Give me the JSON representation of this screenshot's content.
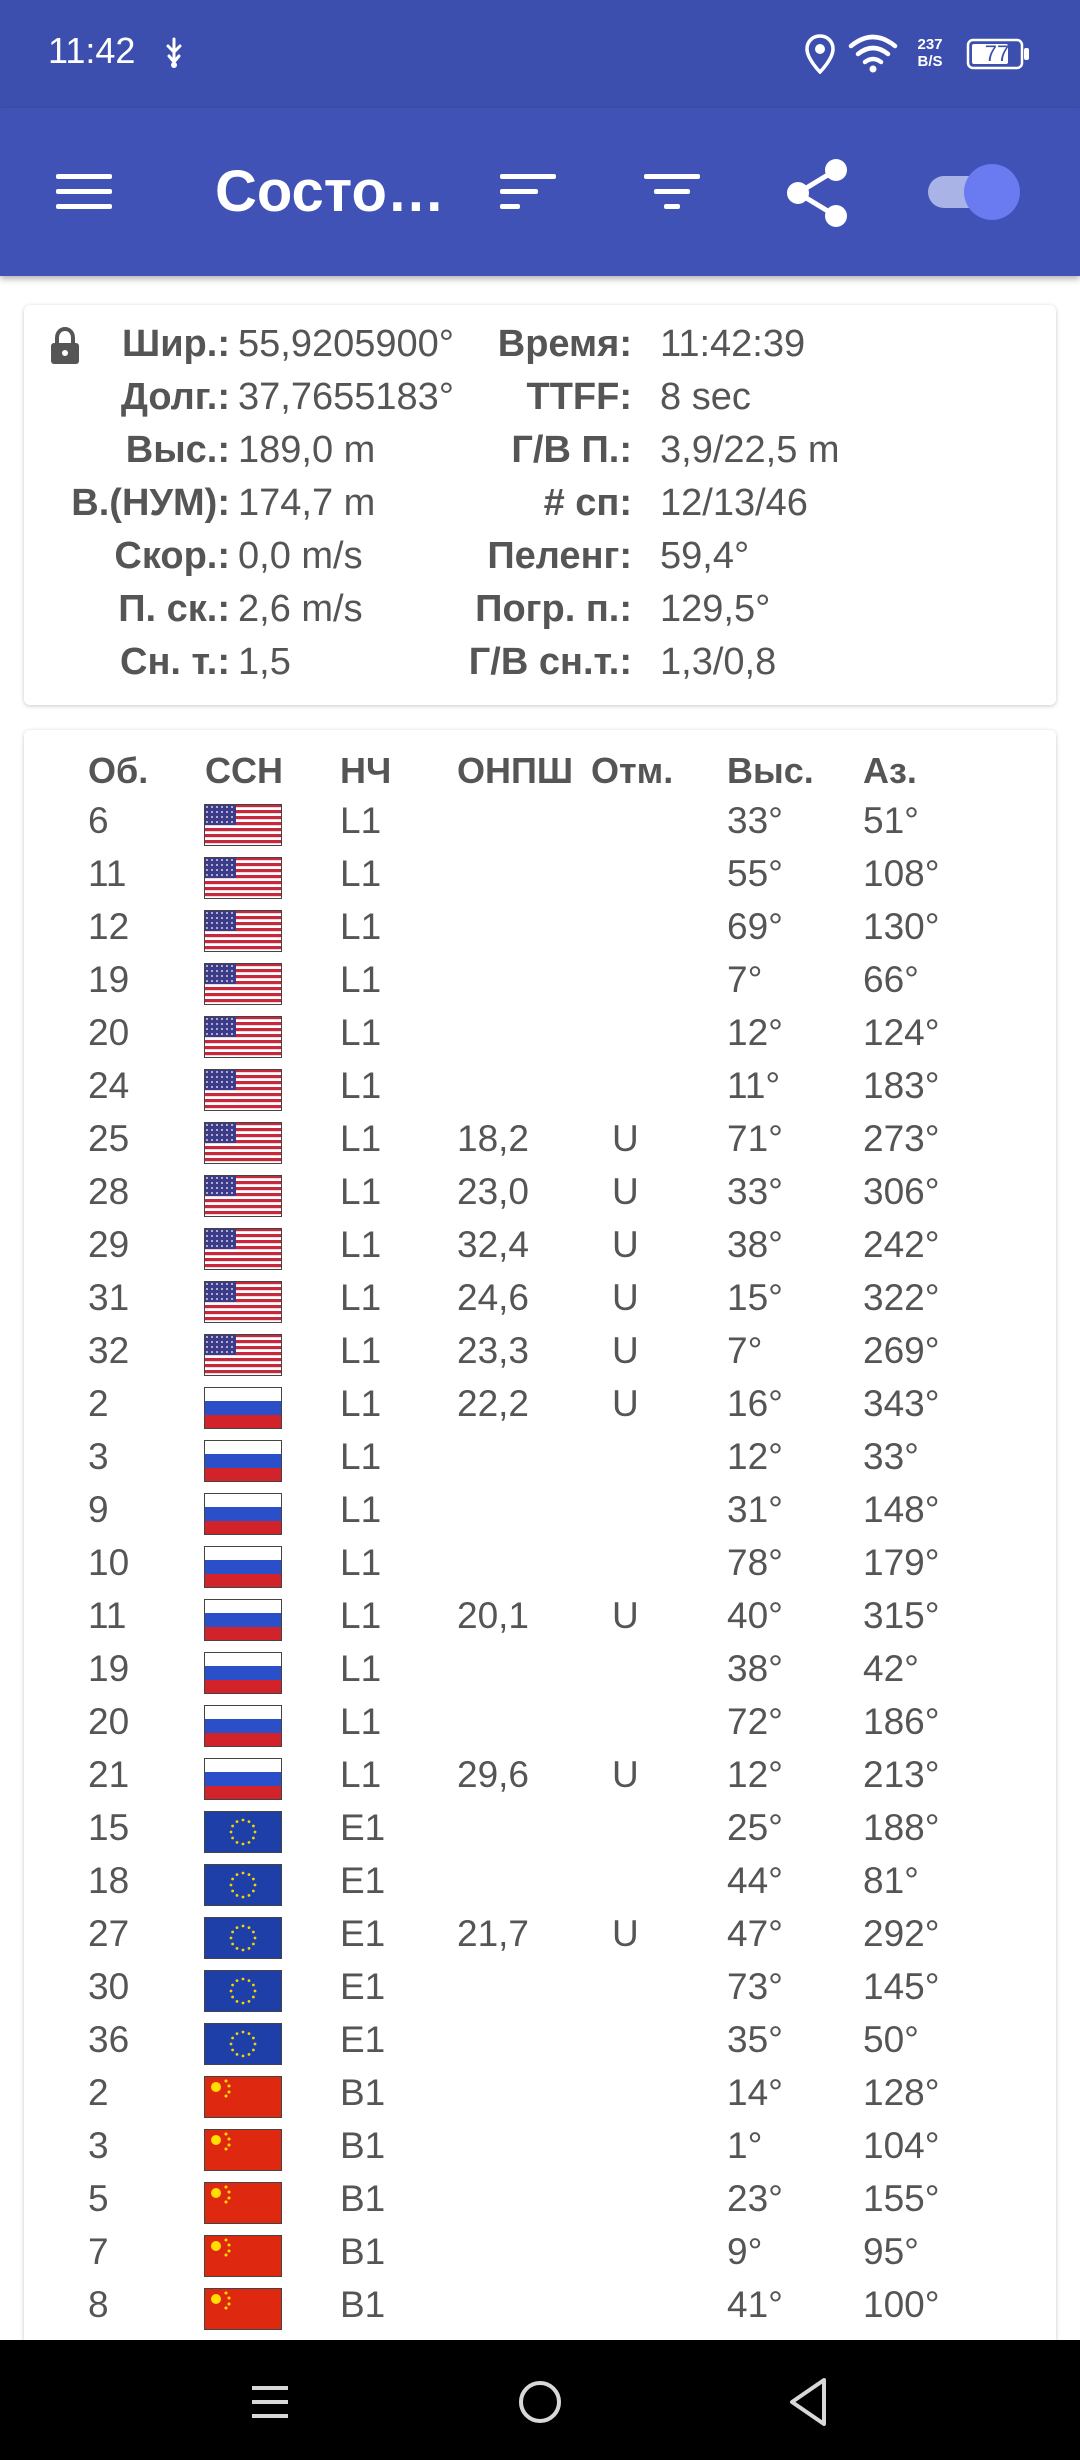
{
  "status_bar": {
    "time": "11:42",
    "speed_value": "237",
    "speed_unit": "B/S",
    "battery": "77",
    "icons": [
      "usb-debug-icon",
      "location-icon",
      "wifi-icon",
      "battery-icon"
    ]
  },
  "app_bar": {
    "title": "Состо…",
    "icons": [
      "menu-icon",
      "sort-icon",
      "filter-icon",
      "share-icon",
      "toggle-switch"
    ],
    "toggle_on": true
  },
  "colors": {
    "status_bar": "#3d4fae",
    "app_bar": "#4052b5",
    "toggle_knob": "#6a7af0",
    "toggle_track": "#aab3e6"
  },
  "location": {
    "rows": [
      {
        "l1": "Шир.:",
        "v1": "55,9205900°",
        "l2": "Время:",
        "v2": "11:42:39"
      },
      {
        "l1": "Долг.:",
        "v1": "37,7655183°",
        "l2": "TTFF:",
        "v2": "8 sec"
      },
      {
        "l1": "Выс.:",
        "v1": "189,0 m",
        "l2": "Г/В П.:",
        "v2": "3,9/22,5 m"
      },
      {
        "l1": "В.(НУМ):",
        "v1": "174,7 m",
        "l2": "# сп:",
        "v2": "12/13/46"
      },
      {
        "l1": "Скор.:",
        "v1": "0,0 m/s",
        "l2": "Пеленг:",
        "v2": "59,4°"
      },
      {
        "l1": "П. ск.:",
        "v1": "2,6 m/s",
        "l2": "Погр. п.:",
        "v2": "129,5°"
      },
      {
        "l1": "Сн. т.:",
        "v1": "1,5",
        "l2": "Г/В сн.т.:",
        "v2": "1,3/0,8"
      }
    ]
  },
  "satellites": {
    "headers": {
      "num": "Об.",
      "gnss": "ССН",
      "band": "НЧ",
      "snr": "ОНПШ",
      "used": "Отм.",
      "elev": "Выс.",
      "az": "Аз."
    },
    "rows": [
      {
        "num": "6",
        "flag": "usa",
        "band": "L1",
        "snr": "",
        "used": "",
        "elev": "33°",
        "az": "51°"
      },
      {
        "num": "11",
        "flag": "usa",
        "band": "L1",
        "snr": "",
        "used": "",
        "elev": "55°",
        "az": "108°"
      },
      {
        "num": "12",
        "flag": "usa",
        "band": "L1",
        "snr": "",
        "used": "",
        "elev": "69°",
        "az": "130°"
      },
      {
        "num": "19",
        "flag": "usa",
        "band": "L1",
        "snr": "",
        "used": "",
        "elev": "7°",
        "az": "66°"
      },
      {
        "num": "20",
        "flag": "usa",
        "band": "L1",
        "snr": "",
        "used": "",
        "elev": "12°",
        "az": "124°"
      },
      {
        "num": "24",
        "flag": "usa",
        "band": "L1",
        "snr": "",
        "used": "",
        "elev": "11°",
        "az": "183°"
      },
      {
        "num": "25",
        "flag": "usa",
        "band": "L1",
        "snr": "18,2",
        "used": "U",
        "elev": "71°",
        "az": "273°"
      },
      {
        "num": "28",
        "flag": "usa",
        "band": "L1",
        "snr": "23,0",
        "used": "U",
        "elev": "33°",
        "az": "306°"
      },
      {
        "num": "29",
        "flag": "usa",
        "band": "L1",
        "snr": "32,4",
        "used": "U",
        "elev": "38°",
        "az": "242°"
      },
      {
        "num": "31",
        "flag": "usa",
        "band": "L1",
        "snr": "24,6",
        "used": "U",
        "elev": "15°",
        "az": "322°"
      },
      {
        "num": "32",
        "flag": "usa",
        "band": "L1",
        "snr": "23,3",
        "used": "U",
        "elev": "7°",
        "az": "269°"
      },
      {
        "num": "2",
        "flag": "russia",
        "band": "L1",
        "snr": "22,2",
        "used": "U",
        "elev": "16°",
        "az": "343°"
      },
      {
        "num": "3",
        "flag": "russia",
        "band": "L1",
        "snr": "",
        "used": "",
        "elev": "12°",
        "az": "33°"
      },
      {
        "num": "9",
        "flag": "russia",
        "band": "L1",
        "snr": "",
        "used": "",
        "elev": "31°",
        "az": "148°"
      },
      {
        "num": "10",
        "flag": "russia",
        "band": "L1",
        "snr": "",
        "used": "",
        "elev": "78°",
        "az": "179°"
      },
      {
        "num": "11",
        "flag": "russia",
        "band": "L1",
        "snr": "20,1",
        "used": "U",
        "elev": "40°",
        "az": "315°"
      },
      {
        "num": "19",
        "flag": "russia",
        "band": "L1",
        "snr": "",
        "used": "",
        "elev": "38°",
        "az": "42°"
      },
      {
        "num": "20",
        "flag": "russia",
        "band": "L1",
        "snr": "",
        "used": "",
        "elev": "72°",
        "az": "186°"
      },
      {
        "num": "21",
        "flag": "russia",
        "band": "L1",
        "snr": "29,6",
        "used": "U",
        "elev": "12°",
        "az": "213°"
      },
      {
        "num": "15",
        "flag": "eu",
        "band": "E1",
        "snr": "",
        "used": "",
        "elev": "25°",
        "az": "188°"
      },
      {
        "num": "18",
        "flag": "eu",
        "band": "E1",
        "snr": "",
        "used": "",
        "elev": "44°",
        "az": "81°"
      },
      {
        "num": "27",
        "flag": "eu",
        "band": "E1",
        "snr": "21,7",
        "used": "U",
        "elev": "47°",
        "az": "292°"
      },
      {
        "num": "30",
        "flag": "eu",
        "band": "E1",
        "snr": "",
        "used": "",
        "elev": "73°",
        "az": "145°"
      },
      {
        "num": "36",
        "flag": "eu",
        "band": "E1",
        "snr": "",
        "used": "",
        "elev": "35°",
        "az": "50°"
      },
      {
        "num": "2",
        "flag": "china",
        "band": "B1",
        "snr": "",
        "used": "",
        "elev": "14°",
        "az": "128°"
      },
      {
        "num": "3",
        "flag": "china",
        "band": "B1",
        "snr": "",
        "used": "",
        "elev": "1°",
        "az": "104°"
      },
      {
        "num": "5",
        "flag": "china",
        "band": "B1",
        "snr": "",
        "used": "",
        "elev": "23°",
        "az": "155°"
      },
      {
        "num": "7",
        "flag": "china",
        "band": "B1",
        "snr": "",
        "used": "",
        "elev": "9°",
        "az": "95°"
      },
      {
        "num": "8",
        "flag": "china",
        "band": "B1",
        "snr": "",
        "used": "",
        "elev": "41°",
        "az": "100°"
      }
    ]
  },
  "nav_bar": {
    "icons": [
      "recents-icon",
      "home-icon",
      "back-icon"
    ]
  }
}
